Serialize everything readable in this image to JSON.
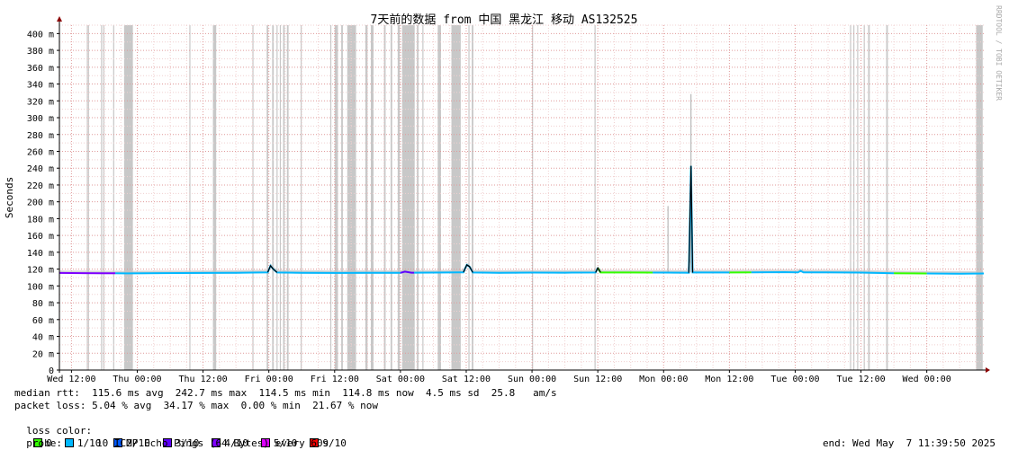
{
  "chart_data": {
    "type": "line",
    "title": "7天前的数据 from 中国 黑龙江 移动 AS132525",
    "ylabel": "Seconds",
    "watermark": "RRDTOOL / TOBI OETIKER",
    "ylim": [
      0,
      410
    ],
    "y_ticks": [
      "0",
      "20 m",
      "40 m",
      "60 m",
      "80 m",
      "100 m",
      "120 m",
      "140 m",
      "160 m",
      "180 m",
      "200 m",
      "220 m",
      "240 m",
      "260 m",
      "280 m",
      "300 m",
      "320 m",
      "340 m",
      "360 m",
      "380 m",
      "400 m"
    ],
    "x_ticks": [
      "Wed 12:00",
      "Thu 00:00",
      "Thu 12:00",
      "Fri 00:00",
      "Fri 12:00",
      "Sat 00:00",
      "Sat 12:00",
      "Sun 00:00",
      "Sun 12:00",
      "Mon 00:00",
      "Mon 12:00",
      "Tue 00:00",
      "Tue 12:00",
      "Wed 00:00"
    ],
    "x_range_hours": [
      -2.2,
      166.4
    ],
    "grid": true,
    "loss_bands_hours": [
      [
        2.8,
        2.9
      ],
      [
        3.0,
        3.2
      ],
      [
        5.4,
        5.6
      ],
      [
        5.8,
        6.0
      ],
      [
        7.6,
        7.8
      ],
      [
        9.6,
        11.2
      ],
      [
        21.5,
        21.7
      ],
      [
        25.8,
        26.4
      ],
      [
        33.0,
        33.2
      ],
      [
        35.6,
        35.9
      ],
      [
        36.6,
        36.9
      ],
      [
        37.4,
        37.6
      ],
      [
        38.0,
        38.2
      ],
      [
        38.6,
        38.9
      ],
      [
        39.3,
        39.6
      ],
      [
        41.8,
        42.0
      ],
      [
        47.2,
        47.4
      ],
      [
        48.0,
        48.6
      ],
      [
        49.2,
        49.5
      ],
      [
        50.3,
        51.9
      ],
      [
        53.6,
        54.0
      ],
      [
        54.6,
        55.1
      ],
      [
        57.0,
        57.3
      ],
      [
        58.2,
        58.5
      ],
      [
        59.5,
        59.9
      ],
      [
        60.3,
        62.6
      ],
      [
        63.0,
        63.3
      ],
      [
        64.0,
        64.2
      ],
      [
        66.8,
        67.4
      ],
      [
        69.3,
        71.0
      ],
      [
        72.4,
        72.6
      ],
      [
        73.0,
        73.3
      ],
      [
        84.0,
        84.2
      ],
      [
        95.4,
        95.6
      ],
      [
        142.0,
        142.2
      ],
      [
        142.6,
        142.8
      ],
      [
        143.3,
        143.5
      ],
      [
        144.5,
        144.7
      ],
      [
        145.3,
        145.6
      ],
      [
        148.6,
        148.9
      ],
      [
        165.0,
        166.2
      ]
    ],
    "median_ms": [
      [
        -2.2,
        115.4
      ],
      [
        2.0,
        115.2
      ],
      [
        6.0,
        115.0
      ],
      [
        10.0,
        114.9
      ],
      [
        16.0,
        115.2
      ],
      [
        24.0,
        115.4
      ],
      [
        30.0,
        115.6
      ],
      [
        35.8,
        116.2
      ],
      [
        36.3,
        124.0
      ],
      [
        36.8,
        120.0
      ],
      [
        37.5,
        116.0
      ],
      [
        42.0,
        115.6
      ],
      [
        48.0,
        115.4
      ],
      [
        54.0,
        115.6
      ],
      [
        60.0,
        115.5
      ],
      [
        60.8,
        117.0
      ],
      [
        62.0,
        115.7
      ],
      [
        66.0,
        115.8
      ],
      [
        71.5,
        116.2
      ],
      [
        72.1,
        125.0
      ],
      [
        72.6,
        123.0
      ],
      [
        73.2,
        116.0
      ],
      [
        78.0,
        115.6
      ],
      [
        84.0,
        115.8
      ],
      [
        90.0,
        115.7
      ],
      [
        95.6,
        116.0
      ],
      [
        96.0,
        121.5
      ],
      [
        96.5,
        116.0
      ],
      [
        102.0,
        115.9
      ],
      [
        108.0,
        115.8
      ],
      [
        112.6,
        115.6
      ],
      [
        113.0,
        242.7
      ],
      [
        113.3,
        115.9
      ],
      [
        118.0,
        115.9
      ],
      [
        124.0,
        116.2
      ],
      [
        130.0,
        116.4
      ],
      [
        132.5,
        116.1
      ],
      [
        133.0,
        118.0
      ],
      [
        133.5,
        116.2
      ],
      [
        138.0,
        116.1
      ],
      [
        144.0,
        115.8
      ],
      [
        150.0,
        115.0
      ],
      [
        156.0,
        114.8
      ],
      [
        162.0,
        114.6
      ],
      [
        166.4,
        114.8
      ]
    ],
    "spikes_ms": [
      [
        108.8,
        195.0
      ],
      [
        113.0,
        328.0
      ]
    ],
    "series": [
      {
        "name": "0",
        "color": "#33ff00"
      },
      {
        "name": "1/10",
        "color": "#00b8ff"
      },
      {
        "name": "2/10",
        "color": "#0059ff"
      },
      {
        "name": "3/10",
        "color": "#5e00ff"
      },
      {
        "name": "4/10",
        "color": "#7e00ff"
      },
      {
        "name": "5/10",
        "color": "#dd00ff"
      },
      {
        "name": "9/10",
        "color": "#ff0000"
      }
    ],
    "loss_color_segments": [
      {
        "from": -2.2,
        "to": 8.0,
        "color": "#7e00ff"
      },
      {
        "from": 8.0,
        "to": 60.0,
        "color": "#00b8ff"
      },
      {
        "from": 60.0,
        "to": 62.5,
        "color": "#5e00ff"
      },
      {
        "from": 62.5,
        "to": 96.0,
        "color": "#00b8ff"
      },
      {
        "from": 96.0,
        "to": 106.0,
        "color": "#33ff00"
      },
      {
        "from": 106.0,
        "to": 120.0,
        "color": "#00b8ff"
      },
      {
        "from": 120.0,
        "to": 124.0,
        "color": "#33ff00"
      },
      {
        "from": 124.0,
        "to": 150.0,
        "color": "#00b8ff"
      },
      {
        "from": 150.0,
        "to": 156.0,
        "color": "#33ff00"
      },
      {
        "from": 156.0,
        "to": 166.4,
        "color": "#00b8ff"
      }
    ]
  },
  "stats": {
    "median_line": "median rtt:  115.6 ms avg  242.7 ms max  114.5 ms min  114.8 ms now  4.5 ms sd  25.8   am/s",
    "loss_line": "packet loss: 5.04 % avg  34.17 % max  0.00 % min  21.67 % now",
    "loss_color_label": "loss color:",
    "probe_label": "probe:",
    "probe_text": "10 ICMP Echo Pings (64 Bytes) every 60s",
    "end_text": "end: Wed May  7 11:39:50 2025"
  }
}
